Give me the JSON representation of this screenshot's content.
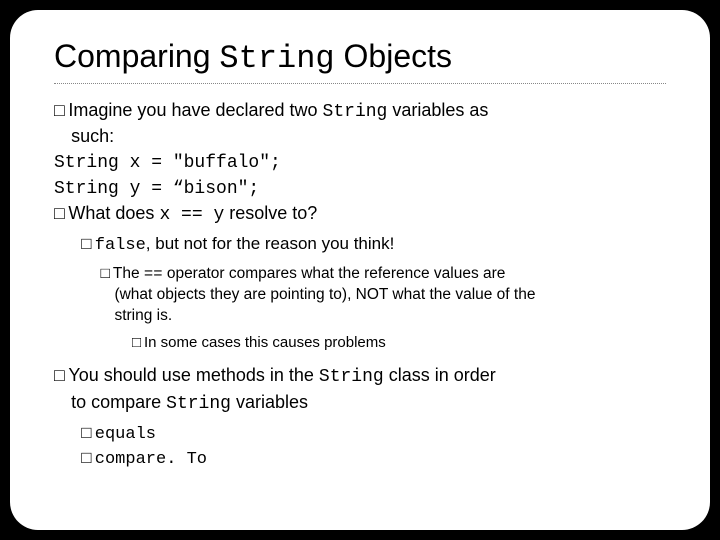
{
  "title": {
    "pre": "Comparing ",
    "code": "String",
    "post": " Objects"
  },
  "lines": {
    "l1a": "Imagine you have declared two ",
    "l1a_code": "String",
    "l1a_post": " variables as",
    "l1b": "such:",
    "l1c": "String x = \"buffalo\";",
    "l1d": "String y = “bison\";",
    "l2a": "What does ",
    "l2a_code": "x == y",
    "l2a_post": "  resolve to?",
    "l3a_code": "false",
    "l3a_post": ", but not for the reason you think!",
    "l4a": "The ",
    "l4a_code": "==",
    "l4a_post": "  operator compares what the reference values are",
    "l4b": "(what objects they are pointing to), NOT what the value of the",
    "l4c": "string is.",
    "l5a": "In some cases this causes problems",
    "l6a": "You should use methods in the ",
    "l6a_code": "String",
    "l6a_post": " class in order",
    "l6b": "to compare ",
    "l6b_code": "String",
    "l6b_post": " variables",
    "l7a": "equals",
    "l7b": "compare. To"
  },
  "bullets": {
    "box": "□"
  }
}
